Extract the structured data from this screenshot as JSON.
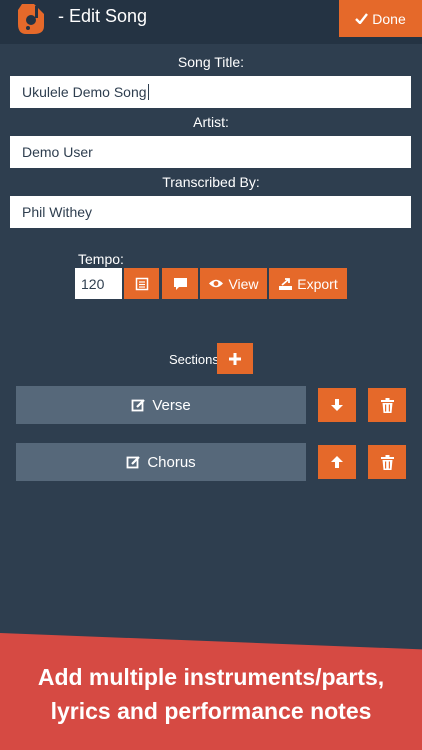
{
  "header": {
    "title": "- Edit Song",
    "done_label": "Done"
  },
  "form": {
    "song_title_label": "Song Title:",
    "song_title_value": "Ukulele Demo Song",
    "artist_label": "Artist:",
    "artist_value": "Demo User",
    "transcribed_label": "Transcribed By:",
    "transcribed_value": "Phil Withey",
    "tempo_label": "Tempo:",
    "tempo_value": "120"
  },
  "toolbar": {
    "view_label": "View",
    "export_label": "Export"
  },
  "sections": {
    "label": "Sections",
    "items": [
      {
        "label": "Verse"
      },
      {
        "label": "Chorus"
      }
    ]
  },
  "banner": {
    "line1": "Add multiple instruments/parts,",
    "line2": "lyrics and performance notes"
  },
  "colors": {
    "background": "#2e3e4f",
    "header": "#243343",
    "accent": "#e5692a",
    "section": "#56687a",
    "banner": "#d64a43"
  }
}
